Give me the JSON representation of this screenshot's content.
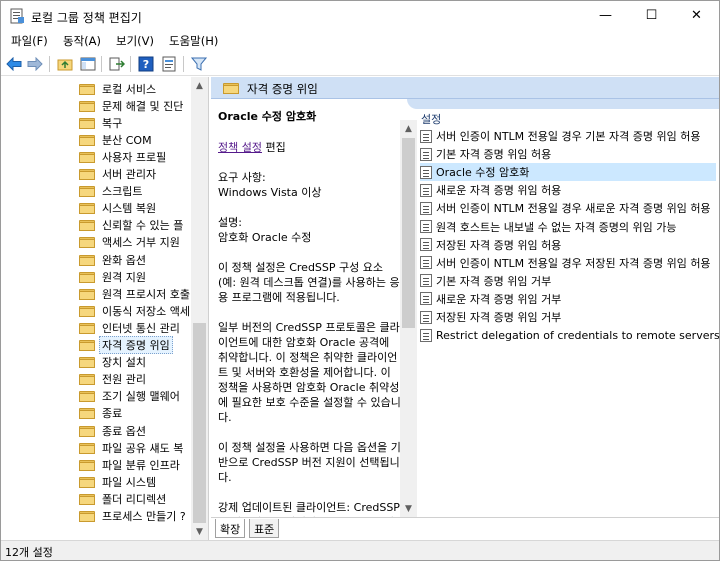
{
  "window": {
    "title": "로컬 그룹 정책 편집기",
    "minimize": "—",
    "maximize": "☐",
    "close": "✕"
  },
  "menu": [
    "파일(F)",
    "동작(A)",
    "보기(V)",
    "도움말(H)"
  ],
  "tree": {
    "items": [
      {
        "label": "로컬 서비스"
      },
      {
        "label": "문제 해결 및 진단"
      },
      {
        "label": "복구"
      },
      {
        "label": "분산 COM"
      },
      {
        "label": "사용자 프로필"
      },
      {
        "label": "서버 관리자"
      },
      {
        "label": "스크립트"
      },
      {
        "label": "시스템 복원"
      },
      {
        "label": "신뢰할 수 있는 플"
      },
      {
        "label": "액세스 거부 지원"
      },
      {
        "label": "완화 옵션"
      },
      {
        "label": "원격 지원"
      },
      {
        "label": "원격 프로시저 호출"
      },
      {
        "label": "이동식 저장소 액세"
      },
      {
        "label": "인터넷 통신 관리"
      },
      {
        "label": "자격 증명 위임",
        "selected": true
      },
      {
        "label": "장치 설치"
      },
      {
        "label": "전원 관리"
      },
      {
        "label": "조기 실행 맬웨어"
      },
      {
        "label": "종료"
      },
      {
        "label": "종료 옵션"
      },
      {
        "label": "파일 공유 섀도 복"
      },
      {
        "label": "파일 분류 인프라"
      },
      {
        "label": "파일 시스템"
      },
      {
        "label": "폴더 리디렉션"
      },
      {
        "label": "프로세스 만들기 ?"
      }
    ]
  },
  "detail": {
    "header_title": "자격 증명 위임",
    "policy_title": "Oracle 수정 암호화",
    "edit_link": "정책 설정",
    "edit_suffix": " 편집",
    "requirements_label": "요구 사항:",
    "requirements_value": "Windows Vista 이상",
    "description_label": "설명:",
    "description_value": "암호화 Oracle 수정",
    "para1": "이 정책 설정은 CredSSP 구성 요소(예: 원격 데스크톱 연결)를 사용하는 응용 프로그램에 적용됩니다.",
    "para2": "일부 버전의 CredSSP 프로토콜은 클라이언트에 대한 암호화 Oracle 공격에 취약합니다.  이 정책은 취약한 클라이언트 및 서버와 호환성을 제어합니다.  이 정책을 사용하면 암호화 Oracle 취약성에 필요한 보호 수준을 설정할 수 있습니다.",
    "para3": "이 정책 설정을 사용하면 다음 옵션을 기반으로 CredSSP 버전 지원이 선택됩니다.",
    "para4": "강제 업데이트된 클라이언트: CredSSP를 사용하는 클라이언트 응용 프로그램은"
  },
  "list": {
    "column_header": "설정",
    "rows": [
      {
        "label": "서버 인증이 NTLM 전용일 경우 기본 자격 증명 위임 허용"
      },
      {
        "label": "기본 자격 증명 위임 허용"
      },
      {
        "label": "Oracle 수정 암호화",
        "selected": true
      },
      {
        "label": "새로운 자격 증명 위임 허용"
      },
      {
        "label": "서버 인증이 NTLM 전용일 경우 새로운 자격 증명 위임 허용"
      },
      {
        "label": "원격 호스트는 내보낼 수 없는 자격 증명의 위임 가능"
      },
      {
        "label": "저장된 자격 증명 위임 허용"
      },
      {
        "label": "서버 인증이 NTLM 전용일 경우 저장된 자격 증명 위임 허용"
      },
      {
        "label": "기본 자격 증명 위임 거부"
      },
      {
        "label": "새로운 자격 증명 위임 거부"
      },
      {
        "label": "저장된 자격 증명 위임 거부"
      },
      {
        "label": "Restrict delegation of credentials to remote servers(원격"
      }
    ]
  },
  "tabs": [
    "확장",
    "표준"
  ],
  "status": "12개 설정",
  "colors": {
    "header_bg": "#cfe0f5",
    "selected_row": "#cce8ff",
    "folder": "#f6d77d"
  }
}
